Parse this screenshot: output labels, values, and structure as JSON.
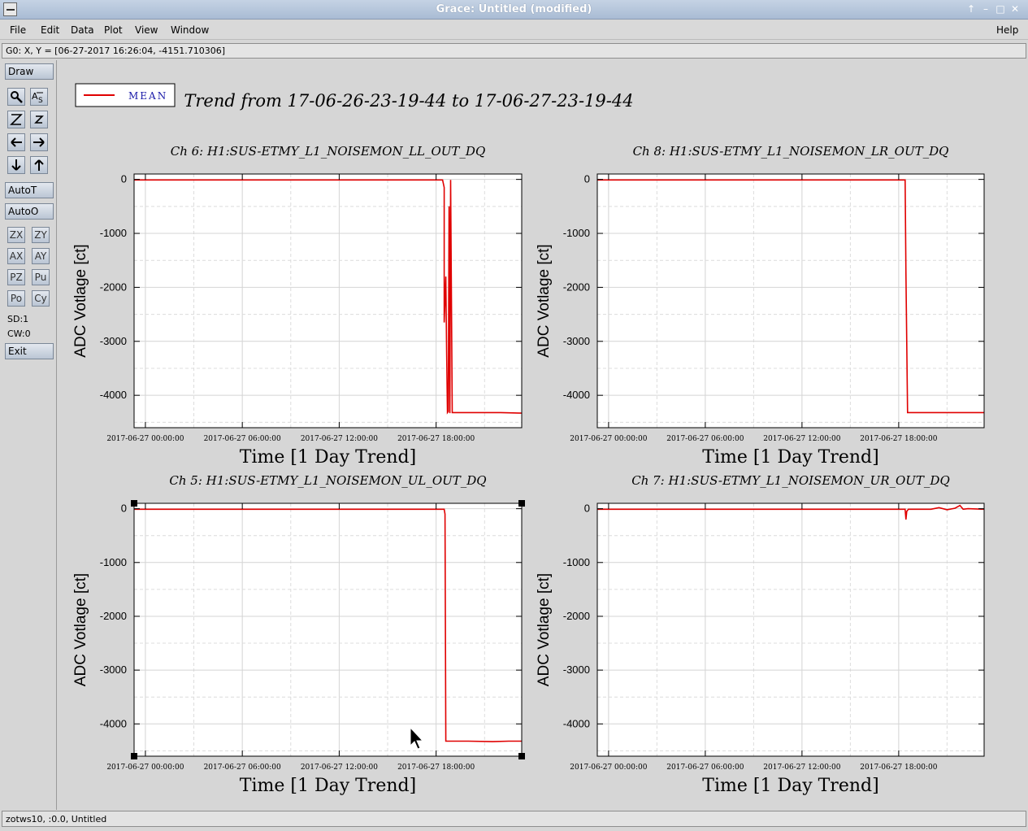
{
  "window": {
    "title": "Grace: Untitled (modified)"
  },
  "menu": {
    "file": "File",
    "edit": "Edit",
    "data": "Data",
    "plot": "Plot",
    "view": "View",
    "window": "Window",
    "help": "Help"
  },
  "locator": {
    "text": "G0: X, Y = [06-27-2017 16:26:04, -4151.710306]"
  },
  "toolbar": {
    "draw": "Draw",
    "autot": "AutoT",
    "autoo": "AutoO",
    "zx": "ZX",
    "zy": "ZY",
    "ax": "AX",
    "ay": "AY",
    "pz": "PZ",
    "pu": "Pu",
    "po": "Po",
    "cy": "Cy",
    "sd": "SD:1",
    "cw": "CW:0",
    "exit": "Exit"
  },
  "legend": {
    "label": "MEAN",
    "color": "#e00000"
  },
  "page_title": "Trend from 17-06-26-23-19-44 to 17-06-27-23-19-44",
  "status": {
    "text": "zotws10, :0.0, Untitled"
  },
  "chart_data": [
    {
      "type": "line",
      "title": "Ch 6: H1:SUS-ETMY_L1_NOISEMON_LL_OUT_DQ",
      "xlabel": "Time [1 Day Trend]",
      "ylabel": "ADC Votlage [ct]",
      "xticks": [
        "2017-06-27 00:00:00",
        "2017-06-27 06:00:00",
        "2017-06-27 12:00:00",
        "2017-06-27 18:00:00"
      ],
      "yticks": [
        "0",
        "-1000",
        "-2000",
        "-3000",
        "-4000"
      ],
      "xlim": [
        -0.7,
        23.3
      ],
      "ylim": [
        -4600,
        100
      ],
      "grid": true,
      "series": [
        {
          "name": "MEAN",
          "x": [
            -0.7,
            18.4,
            18.5,
            18.5,
            18.6,
            18.65,
            18.7,
            18.75,
            18.8,
            18.85,
            18.9,
            19.0,
            20.0,
            21.0,
            22.0,
            23.3
          ],
          "y": [
            -10,
            -10,
            -150,
            -2650,
            -1800,
            -3200,
            -4320,
            -4300,
            -500,
            -4330,
            -10,
            -4320,
            -4320,
            -4320,
            -4320,
            -4330
          ]
        }
      ]
    },
    {
      "type": "line",
      "title": "Ch 8: H1:SUS-ETMY_L1_NOISEMON_LR_OUT_DQ",
      "xlabel": "Time [1 Day Trend]",
      "ylabel": "ADC Votlage [ct]",
      "xticks": [
        "2017-06-27 00:00:00",
        "2017-06-27 06:00:00",
        "2017-06-27 12:00:00",
        "2017-06-27 18:00:00"
      ],
      "yticks": [
        "0",
        "-1000",
        "-2000",
        "-3000",
        "-4000"
      ],
      "xlim": [
        -0.7,
        23.3
      ],
      "ylim": [
        -4600,
        100
      ],
      "grid": true,
      "series": [
        {
          "name": "MEAN",
          "x": [
            -0.7,
            18.4,
            18.45,
            18.45,
            18.55,
            20.0,
            23.3
          ],
          "y": [
            -10,
            -10,
            -1750,
            -1750,
            -4320,
            -4320,
            -4320
          ]
        }
      ]
    },
    {
      "type": "line",
      "title": "Ch 5: H1:SUS-ETMY_L1_NOISEMON_UL_OUT_DQ",
      "xlabel": "Time [1 Day Trend]",
      "ylabel": "ADC Votlage [ct]",
      "xticks": [
        "2017-06-27 00:00:00",
        "2017-06-27 06:00:00",
        "2017-06-27 12:00:00",
        "2017-06-27 18:00:00"
      ],
      "yticks": [
        "0",
        "-1000",
        "-2000",
        "-3000",
        "-4000"
      ],
      "xlim": [
        -0.7,
        23.3
      ],
      "ylim": [
        -4600,
        100
      ],
      "grid": true,
      "series": [
        {
          "name": "MEAN",
          "x": [
            -0.7,
            18.5,
            18.55,
            18.6,
            20.0,
            21.5,
            22.5,
            23.3
          ],
          "y": [
            -10,
            -10,
            -100,
            -4320,
            -4320,
            -4330,
            -4320,
            -4320
          ]
        }
      ]
    },
    {
      "type": "line",
      "title": "Ch 7: H1:SUS-ETMY_L1_NOISEMON_UR_OUT_DQ",
      "xlabel": "Time [1 Day Trend]",
      "ylabel": "ADC Votlage [ct]",
      "xticks": [
        "2017-06-27 00:00:00",
        "2017-06-27 06:00:00",
        "2017-06-27 12:00:00",
        "2017-06-27 18:00:00"
      ],
      "yticks": [
        "0",
        "-1000",
        "-2000",
        "-3000",
        "-4000"
      ],
      "xlim": [
        -0.7,
        23.3
      ],
      "ylim": [
        -4600,
        100
      ],
      "grid": true,
      "series": [
        {
          "name": "MEAN",
          "x": [
            -0.7,
            18.4,
            18.45,
            18.5,
            18.6,
            20.0,
            20.5,
            21.0,
            21.5,
            21.8,
            22.0,
            22.3,
            23.3
          ],
          "y": [
            -10,
            -10,
            -200,
            -50,
            -10,
            -10,
            20,
            -20,
            10,
            60,
            -10,
            0,
            -10
          ]
        }
      ]
    }
  ]
}
